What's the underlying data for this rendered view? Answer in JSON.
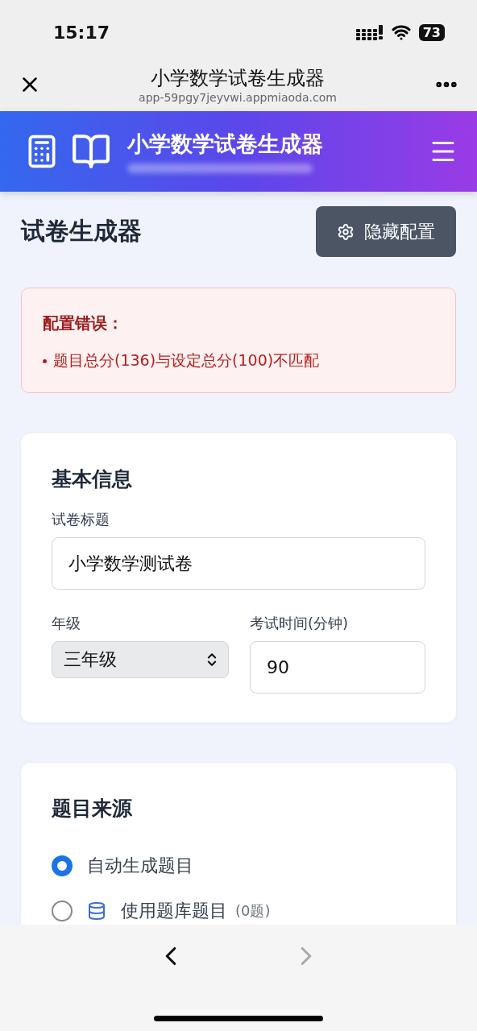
{
  "status_bar": {
    "time": "15:17",
    "battery": "73"
  },
  "browser": {
    "title": "小学数学试卷生成器",
    "url": "app-59pgy7jeyvwi.appmiaoda.com"
  },
  "header": {
    "title": "小学数学试卷生成器"
  },
  "page": {
    "title": "试卷生成器",
    "toggle_button": "隐藏配置"
  },
  "error": {
    "title": "配置错误：",
    "items": [
      "题目总分(136)与设定总分(100)不匹配"
    ]
  },
  "basic_info": {
    "title": "基本信息",
    "paper_title_label": "试卷标题",
    "paper_title_value": "小学数学测试卷",
    "grade_label": "年级",
    "grade_value": "三年级",
    "time_label": "考试时间(分钟)",
    "time_value": "90"
  },
  "source": {
    "title": "题目来源",
    "options": [
      {
        "label": "自动生成题目",
        "selected": true
      },
      {
        "label": "使用题库题目",
        "count": "(0题)",
        "selected": false,
        "kind": "bank"
      }
    ]
  }
}
